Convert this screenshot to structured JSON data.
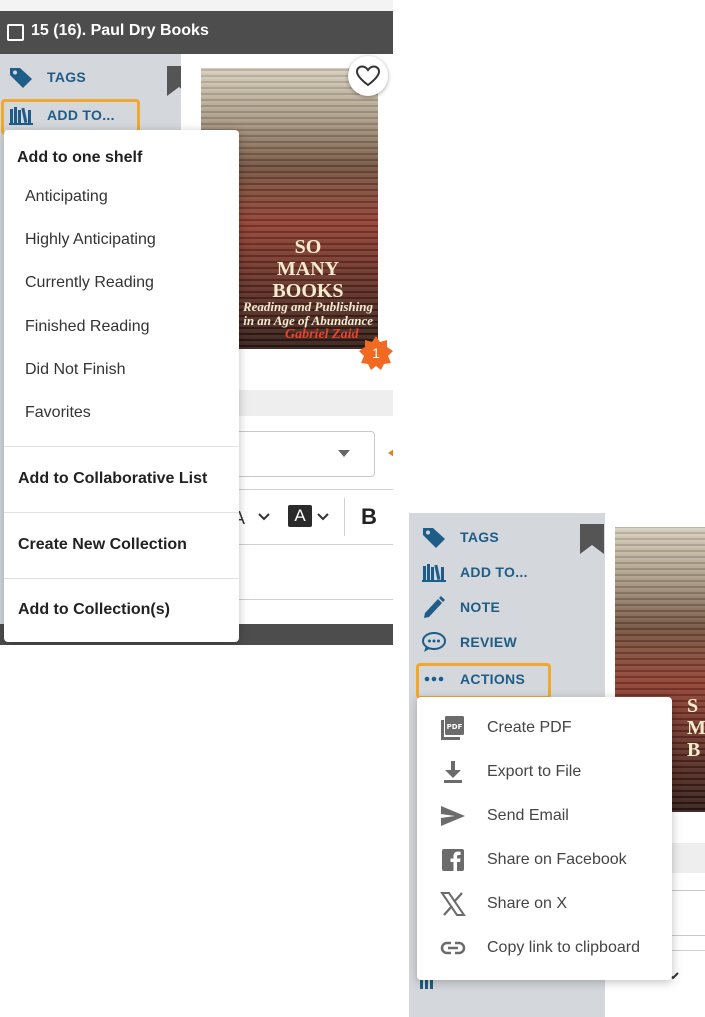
{
  "panel1": {
    "header": {
      "title": "15 (16). Paul Dry Books"
    },
    "sidebar": {
      "tags_label": "TAGS",
      "add_to_label": "ADD TO..."
    },
    "book": {
      "cover_title_lines": [
        "SO",
        "MANY",
        "BOOKS"
      ],
      "cover_subtitle_lines": [
        "Reading and Publishing",
        "in an Age of Abundance"
      ],
      "cover_author": "Gabriel Zaid",
      "badge_count": "1"
    },
    "add_to_menu": {
      "shelf_heading": "Add to one shelf",
      "shelves": [
        "Anticipating",
        "Highly Anticipating",
        "Currently Reading",
        "Finished Reading",
        "Did Not Finish",
        "Favorites"
      ],
      "collab_label": "Add to Collaborative List",
      "new_collection_label": "Create New Collection",
      "add_collection_label": "Add to Collection(s)"
    },
    "toolbar": {
      "bold_label": "B"
    }
  },
  "panel2": {
    "sidebar": {
      "tags_label": "TAGS",
      "add_to_label": "ADD TO...",
      "note_label": "NOTE",
      "review_label": "REVIEW",
      "actions_label": "ACTIONS"
    },
    "cover_letters": [
      "S",
      "M",
      "B"
    ],
    "actions_menu": [
      {
        "label": "Create PDF",
        "icon": "pdf-icon"
      },
      {
        "label": "Export to File",
        "icon": "download-icon"
      },
      {
        "label": "Send Email",
        "icon": "send-icon"
      },
      {
        "label": "Share on Facebook",
        "icon": "facebook-icon"
      },
      {
        "label": "Share on X",
        "icon": "x-logo-icon"
      },
      {
        "label": "Copy link to clipboard",
        "icon": "link-icon"
      }
    ]
  },
  "colors": {
    "accent_blue": "#1e5d87",
    "highlight_orange": "#f0a830",
    "header_gray": "#4d4d4d",
    "sidebar_gray": "#d4d8dc",
    "badge_orange": "#f26a21"
  }
}
